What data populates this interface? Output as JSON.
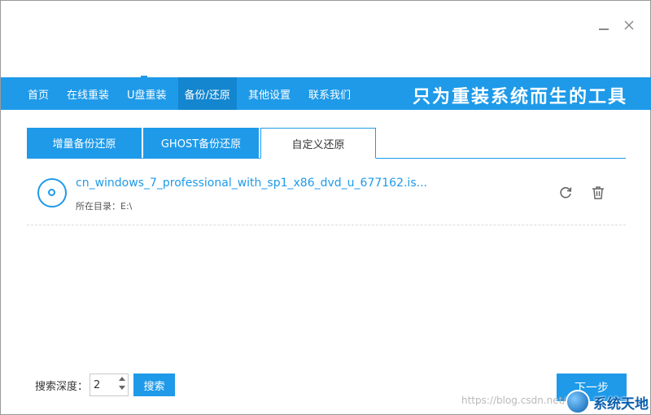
{
  "nav": {
    "items": [
      {
        "label": "首页"
      },
      {
        "label": "在线重装"
      },
      {
        "label": "U盘重装"
      },
      {
        "label": "备份/还原"
      },
      {
        "label": "其他设置"
      },
      {
        "label": "联系我们"
      }
    ],
    "active_index": 3,
    "slogan": "只为重装系统而生的工具"
  },
  "tabs": [
    {
      "label": "增量备份还原"
    },
    {
      "label": "GHOST备份还原"
    },
    {
      "label": "自定义还原"
    }
  ],
  "selected_tab": 2,
  "file": {
    "name": "cn_windows_7_professional_with_sp1_x86_dvd_u_677162.is...",
    "path_label": "所在目录：E:\\"
  },
  "search": {
    "depth_label": "搜索深度：",
    "depth_value": "2",
    "button_label": "搜索"
  },
  "next_label": "下一步",
  "watermark": {
    "url_text": "https://blog.csdn.net/",
    "brand_text": "系统天地"
  },
  "colors": {
    "accent": "#1e9ae9",
    "accent_dark": "#1386cf"
  },
  "icons": {
    "disc": "disc-icon",
    "restore": "refresh-icon",
    "delete": "trash-icon",
    "minimize": "minimize-icon",
    "close": "close-icon"
  }
}
